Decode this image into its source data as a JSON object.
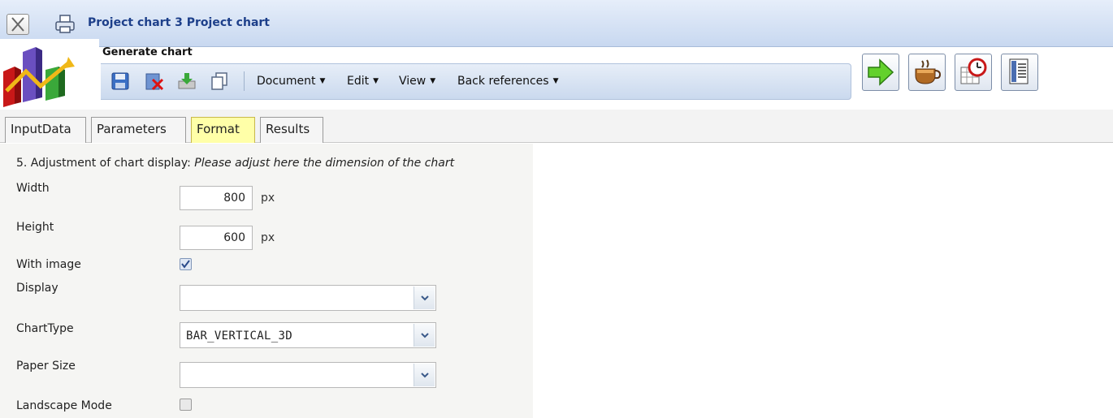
{
  "window": {
    "title": "Project chart 3 Project chart"
  },
  "toolbar": {
    "section_label": "Generate chart",
    "menus": [
      {
        "label": "Document"
      },
      {
        "label": "Edit"
      },
      {
        "label": "View"
      },
      {
        "label": "Back references"
      }
    ],
    "icons": [
      "save-icon",
      "delete-icon",
      "download-icon",
      "copy-icon"
    ],
    "action_buttons": [
      "run-arrow-icon",
      "coffee-icon",
      "schedule-icon",
      "report-icon"
    ]
  },
  "tabs": [
    {
      "label": "InputData",
      "active": false
    },
    {
      "label": "Parameters",
      "active": false
    },
    {
      "label": "Format",
      "active": true
    },
    {
      "label": "Results",
      "active": false
    }
  ],
  "form": {
    "section_prefix": "5. Adjustment of chart display: ",
    "section_hint": "Please adjust here the dimension of the chart",
    "width": {
      "label": "Width",
      "value": "800",
      "unit": "px"
    },
    "height": {
      "label": "Height",
      "value": "600",
      "unit": "px"
    },
    "with_image": {
      "label": "With image",
      "checked": true
    },
    "display": {
      "label": "Display",
      "value": ""
    },
    "chart_type": {
      "label": "ChartType",
      "value": "BAR_VERTICAL_3D"
    },
    "paper_size": {
      "label": "Paper Size",
      "value": ""
    },
    "landscape": {
      "label": "Landscape Mode",
      "checked": false
    }
  },
  "colors": {
    "title_text": "#1d3f8a",
    "active_tab": "#ffffa8",
    "toolbar_bg": "#cad9ee"
  }
}
